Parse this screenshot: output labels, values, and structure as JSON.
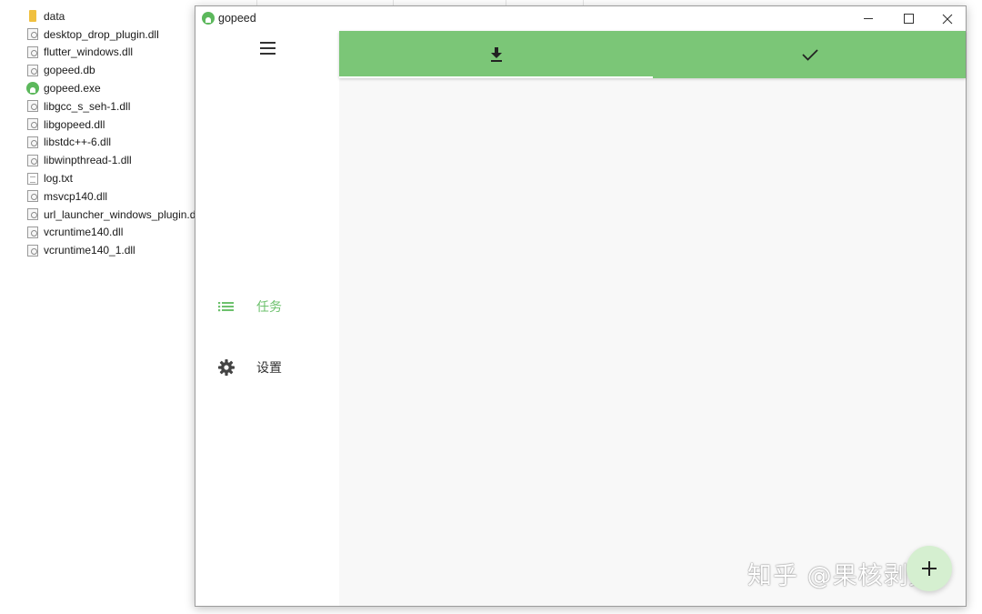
{
  "explorer": {
    "files": [
      {
        "name": "data",
        "type": "folder"
      },
      {
        "name": "desktop_drop_plugin.dll",
        "type": "dll"
      },
      {
        "name": "flutter_windows.dll",
        "type": "dll"
      },
      {
        "name": "gopeed.db",
        "type": "dll"
      },
      {
        "name": "gopeed.exe",
        "type": "exe"
      },
      {
        "name": "libgcc_s_seh-1.dll",
        "type": "dll"
      },
      {
        "name": "libgopeed.dll",
        "type": "dll"
      },
      {
        "name": "libstdc++-6.dll",
        "type": "dll"
      },
      {
        "name": "libwinpthread-1.dll",
        "type": "dll"
      },
      {
        "name": "log.txt",
        "type": "txt"
      },
      {
        "name": "msvcp140.dll",
        "type": "dll"
      },
      {
        "name": "url_launcher_windows_plugin.dll",
        "type": "dll"
      },
      {
        "name": "vcruntime140.dll",
        "type": "dll"
      },
      {
        "name": "vcruntime140_1.dll",
        "type": "dll"
      }
    ]
  },
  "window": {
    "title": "gopeed",
    "icon": "gopeed-logo-icon"
  },
  "sidebar": {
    "menu_icon": "hamburger-menu-icon",
    "items": [
      {
        "label": "任务",
        "icon": "list-icon",
        "active": true
      },
      {
        "label": "设置",
        "icon": "gear-icon",
        "active": false
      }
    ]
  },
  "tabs": [
    {
      "icon": "download-icon",
      "active": true
    },
    {
      "icon": "checkmark-icon",
      "active": false
    }
  ],
  "fab": {
    "icon": "plus-icon"
  },
  "watermark": "知乎 @果核剥壳",
  "colors": {
    "accent": "#7bc677",
    "active_text": "#6dc16d",
    "fab_bg": "#d5efd0",
    "content_bg": "#f8f8f8"
  }
}
